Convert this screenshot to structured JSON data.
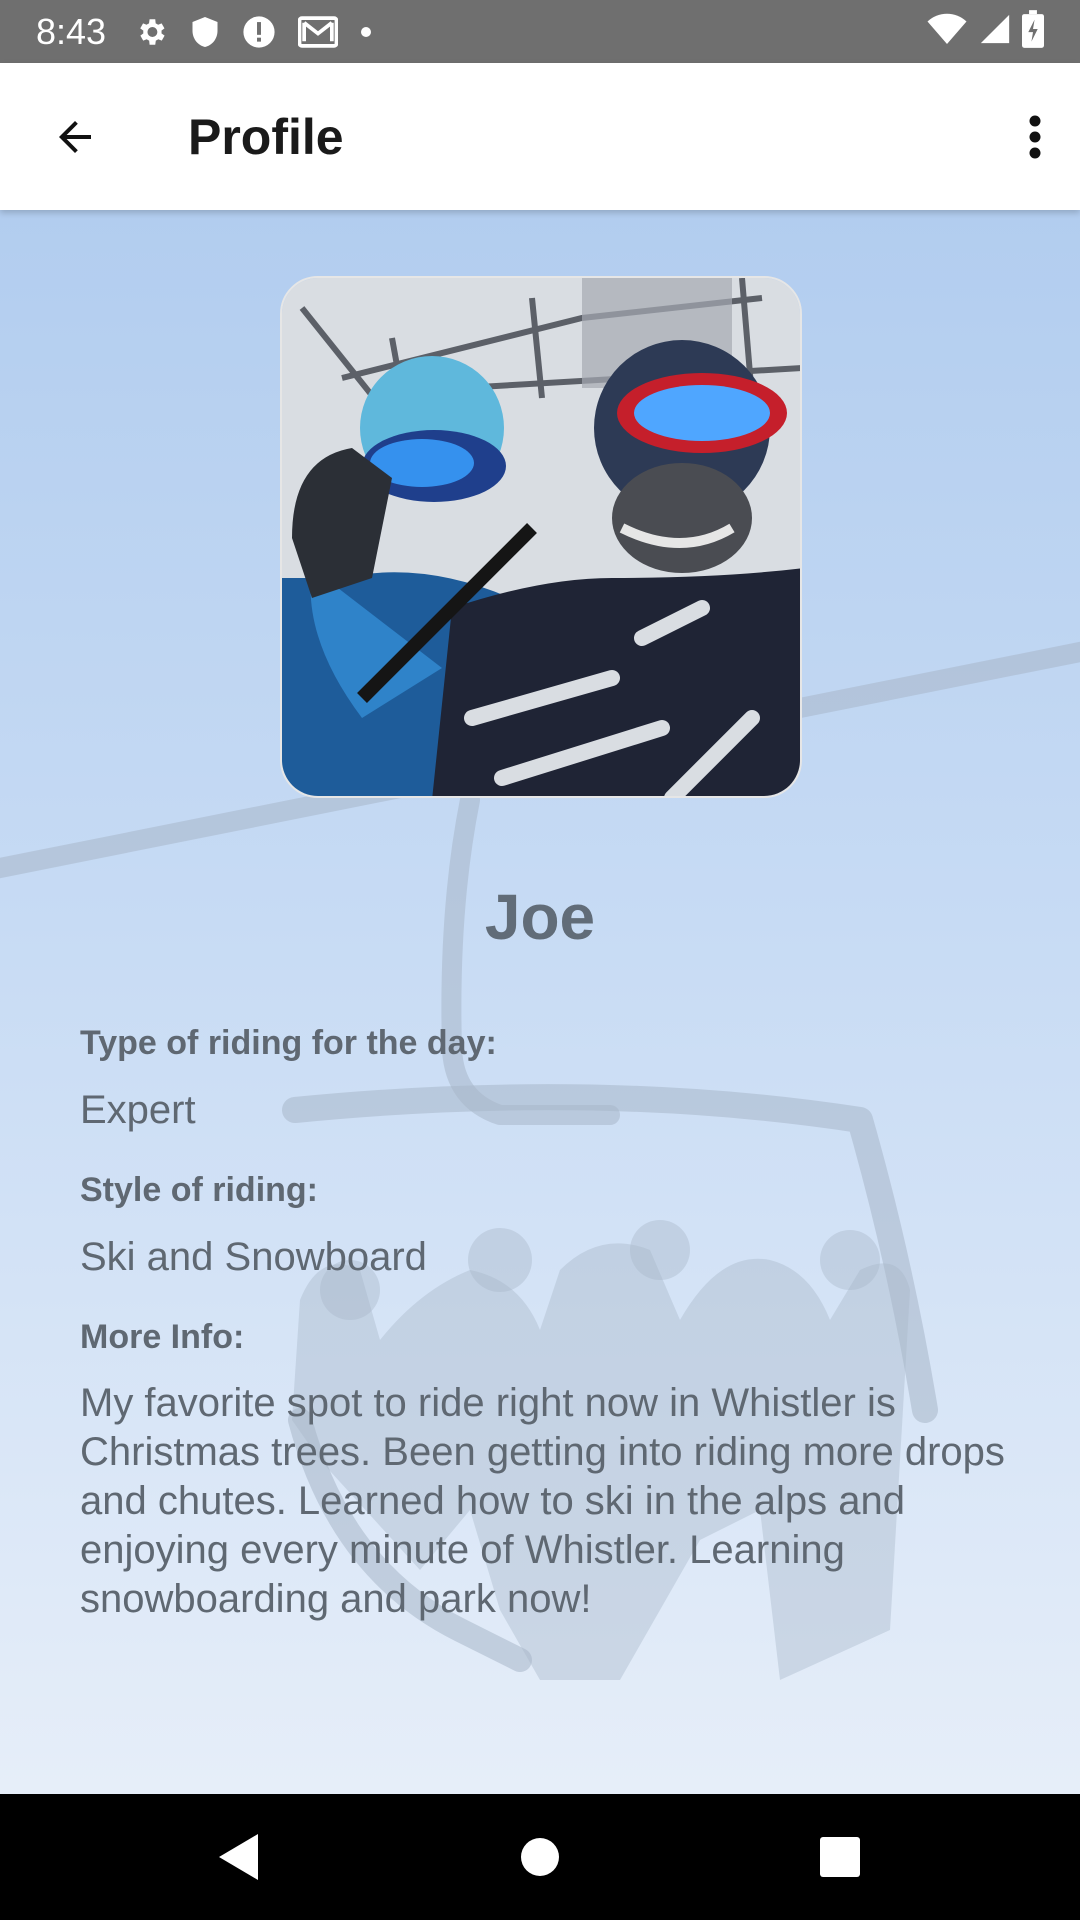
{
  "status_bar": {
    "time": "8:43",
    "left_icons": [
      "settings-icon",
      "shield-icon",
      "alert-icon",
      "gmail-icon",
      "dot-icon"
    ],
    "right_icons": [
      "wifi-icon",
      "cell-signal-icon",
      "battery-charging-icon"
    ]
  },
  "app_bar": {
    "title": "Profile",
    "back_icon": "arrow-back-icon",
    "menu_icon": "more-vert-icon"
  },
  "profile": {
    "photo_alt": "Profile photo",
    "name": "Joe",
    "fields": [
      {
        "label": "Type of riding for the day:",
        "value": "Expert"
      },
      {
        "label": "Style of riding:",
        "value": "Ski and Snowboard"
      },
      {
        "label": "More Info:",
        "value": "My favorite spot to ride right now in Whistler is Christmas trees.  Been getting into riding more drops and chutes.  Learned how to ski in the alps and enjoying every minute of Whistler.  Learning snowboarding and park now!"
      }
    ]
  },
  "nav_bar": {
    "buttons": [
      "back-triangle-icon",
      "home-circle-icon",
      "recents-square-icon"
    ]
  },
  "colors": {
    "status_bar_bg": "#6f6f6f",
    "app_bar_bg": "#ffffff",
    "content_text": "#5f6872",
    "nav_bar_bg": "#000000"
  }
}
